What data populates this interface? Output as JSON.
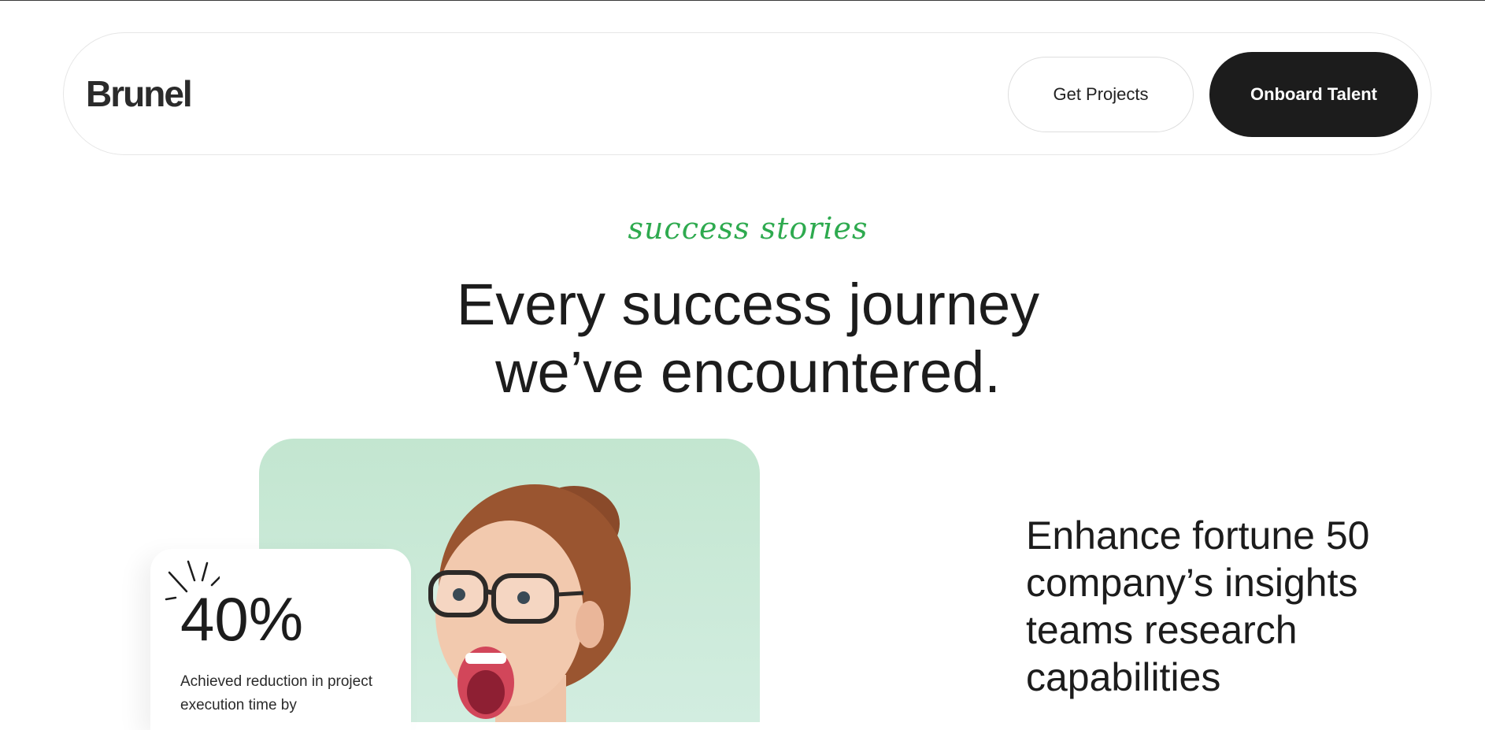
{
  "header": {
    "logo_text": "Brunel",
    "get_projects_label": "Get Projects",
    "onboard_talent_label": "Onboard Talent"
  },
  "hero": {
    "eyebrow": "success stories",
    "headline_line1": "Every success journey",
    "headline_line2": "we’ve encountered."
  },
  "story": {
    "stat_value": "40%",
    "stat_description": "Achieved reduction in project execution time by",
    "title": "Enhance fortune 50 company’s insights teams research capabilities"
  },
  "colors": {
    "accent_green": "#2eaa4f",
    "dark_button": "#1c1c1c",
    "photo_bg": "#c3e6d0"
  }
}
